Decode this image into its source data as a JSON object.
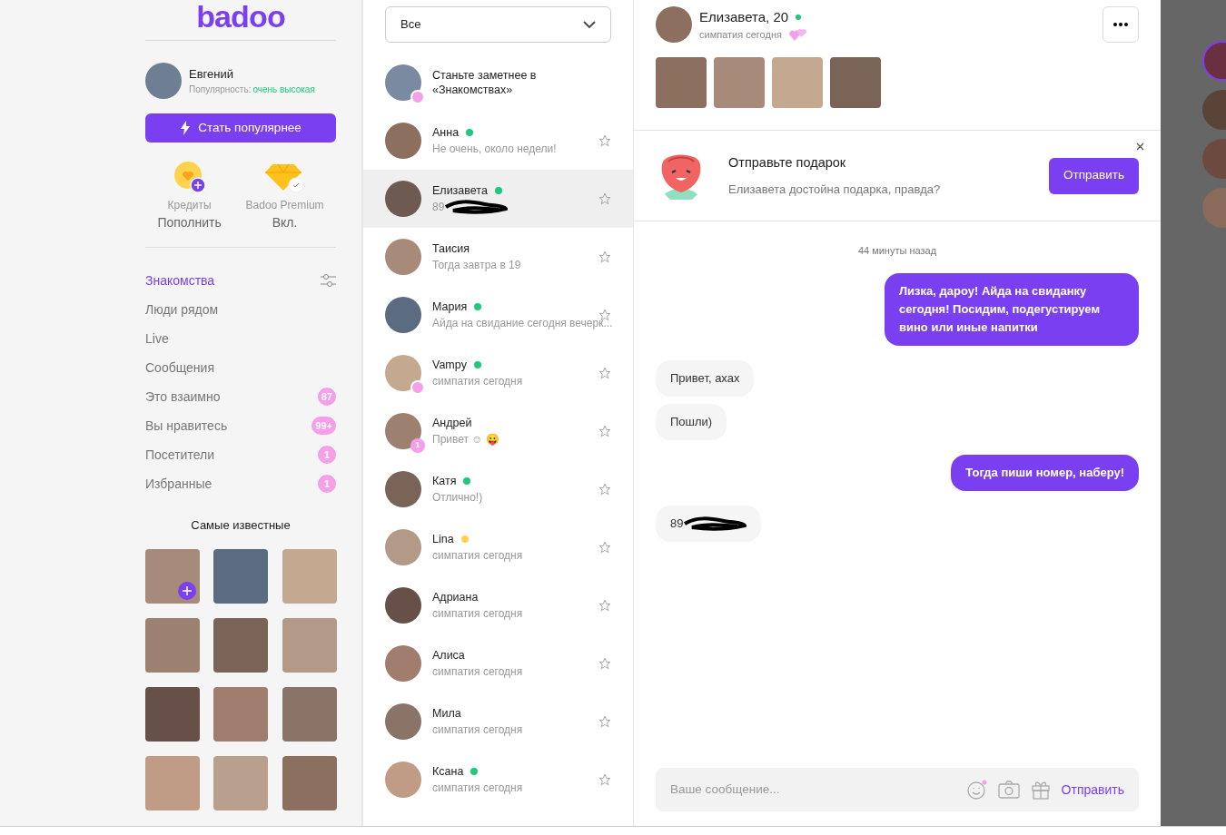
{
  "logo": "badoo",
  "profile": {
    "name": "Евгений",
    "popularity_label": "Популярность:",
    "popularity_value": "очень высокая"
  },
  "boost_button": "Стать популярнее",
  "wallet": [
    {
      "kind": "credits",
      "label": "Кредиты",
      "action": "Пополнить"
    },
    {
      "kind": "premium",
      "label": "Badoo Premium",
      "action": "Вкл."
    }
  ],
  "nav": [
    {
      "label": "Знакомства",
      "selected": true,
      "kind": "filter"
    },
    {
      "label": "Люди рядом",
      "selected": false
    },
    {
      "label": "Live",
      "selected": false
    },
    {
      "label": "Сообщения",
      "selected": false
    },
    {
      "label": "Это взаимно",
      "selected": false,
      "count": "87"
    },
    {
      "label": "Вы нравитесь",
      "selected": false,
      "count": "99+"
    },
    {
      "label": "Посетители",
      "selected": false,
      "count": "1"
    },
    {
      "label": "Избранные",
      "selected": false,
      "count": "1"
    }
  ],
  "popular": {
    "title": "Самые известные",
    "photos": [
      {
        "add": true
      },
      {
        "add": false
      },
      {
        "add": false
      },
      {
        "add": false
      },
      {
        "add": false
      },
      {
        "add": false
      },
      {
        "add": false
      },
      {
        "add": false
      },
      {
        "add": false
      },
      {
        "add": false
      },
      {
        "add": false
      },
      {
        "add": false
      }
    ]
  },
  "filter": {
    "value": "Все"
  },
  "conversations": [
    {
      "kind": "promo",
      "title": "Станьте заметнее в «Знакомствах»",
      "badge": {
        "kind": "camera"
      }
    },
    {
      "name": "Анна",
      "color": "#1ec97a",
      "preview": "Не очень, около недели!",
      "selected": false,
      "starred": false
    },
    {
      "name": "Елизавета",
      "color": "#1ec97a",
      "preview": "89",
      "redacted": true,
      "selected": true,
      "starred": false
    },
    {
      "name": "Таисия",
      "preview": "Тогда завтра в 19",
      "selected": false,
      "starred": false
    },
    {
      "name": "Мария",
      "color": "#1ec97a",
      "preview": "Айда на свидание сегодня вечерк...",
      "selected": false,
      "starred": false
    },
    {
      "name": "Vampy",
      "color": "#1ec97a",
      "preview": "симпатия сегодня",
      "badge": {
        "kind": "heart"
      },
      "selected": false,
      "starred": false
    },
    {
      "name": "Андрей",
      "preview": "Привет ☺ 😛",
      "badge_count": "1",
      "selected": false,
      "starred": false
    },
    {
      "name": "Катя",
      "color": "#1ec97a",
      "preview": "Отлично!)",
      "selected": false,
      "starred": false
    },
    {
      "name": "Lina",
      "color": "#ffd24d",
      "preview": "симпатия сегодня",
      "selected": false,
      "starred": false
    },
    {
      "name": "Адриана",
      "preview": "симпатия сегодня",
      "selected": false,
      "starred": false
    },
    {
      "name": "Алиса",
      "preview": "симпатия сегодня",
      "selected": false,
      "starred": false
    },
    {
      "name": "Мила",
      "preview": "симпатия сегодня",
      "selected": false,
      "starred": false
    },
    {
      "name": "Ксана",
      "color": "#1ec97a",
      "preview": "симпатия сегодня",
      "selected": false,
      "starred": false
    }
  ],
  "chat": {
    "name": "Елизавета, 20",
    "online": true,
    "subtitle": "симпатия сегодня",
    "photos": [
      {
        "kind": "photo"
      },
      {
        "kind": "photo"
      },
      {
        "kind": "photo"
      },
      {
        "kind": "photo"
      }
    ],
    "gift": {
      "title": "Отправьте подарок",
      "text": "Елизавета достойна подарка, правда?",
      "button": "Отправить"
    },
    "time": "44 минуты назад",
    "messages": [
      {
        "mine": true,
        "text": "Лизка, дароу! Айда на свиданку сегодня! Посидим, подегустируем вино или иные напитки"
      },
      {
        "mine": false,
        "text": "Привет, ахах"
      },
      {
        "mine": false,
        "text": "Пошли)"
      },
      {
        "mine": true,
        "text": "Тогда пиши номер, наберу!"
      },
      {
        "mine": false,
        "text": "89",
        "redacted": true
      }
    ],
    "composer": {
      "placeholder": "Ваше сообщение...",
      "send": "Отправить"
    }
  }
}
